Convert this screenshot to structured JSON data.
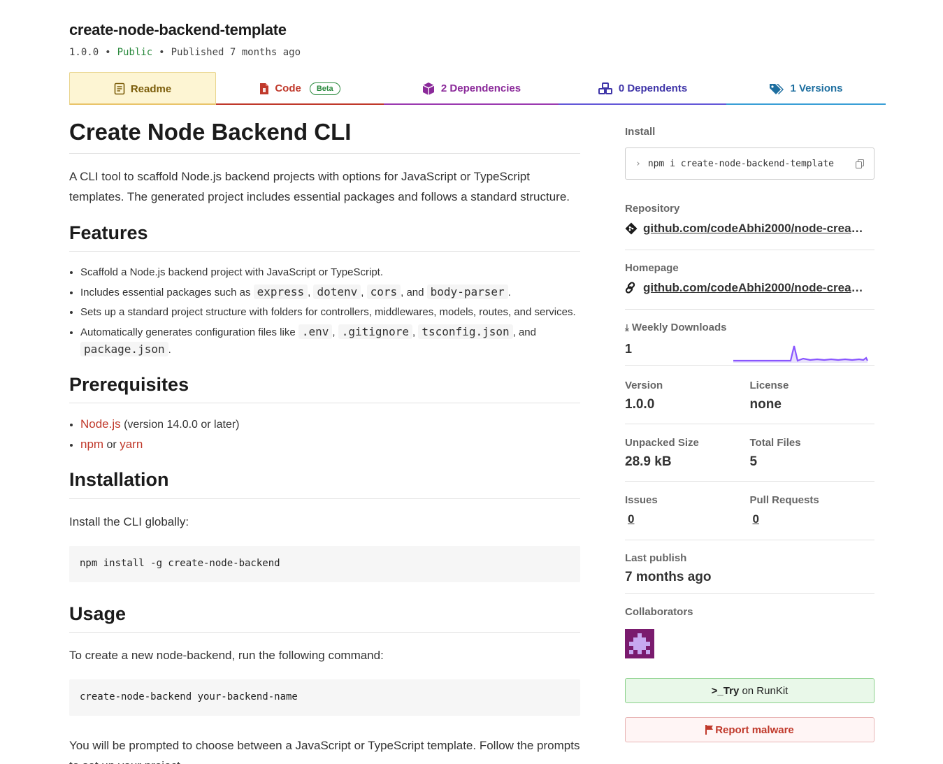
{
  "package": {
    "name": "create-node-backend-template",
    "version": "1.0.0",
    "visibility": "Public",
    "published": "Published 7 months ago"
  },
  "tabs": [
    {
      "label": "Readme",
      "icon": "readme-icon"
    },
    {
      "label": "Code",
      "badge": "Beta",
      "icon": "code-file-icon"
    },
    {
      "label": "2 Dependencies",
      "icon": "box-icon"
    },
    {
      "label": "0 Dependents",
      "icon": "boxes-icon"
    },
    {
      "label": "1 Versions",
      "icon": "tags-icon"
    }
  ],
  "readme": {
    "title": "Create Node Backend CLI",
    "intro": "A CLI tool to scaffold Node.js backend projects with options for JavaScript or TypeScript templates. The generated project includes essential packages and follows a standard structure.",
    "features_heading": "Features",
    "features": {
      "f1": "Scaffold a Node.js backend project with JavaScript or TypeScript.",
      "f2_pre": "Includes essential packages such as",
      "f2_c1": "express",
      "f2_c2": "dotenv",
      "f2_c3": "cors",
      "f2_and": ", and",
      "f2_c4": "body-parser",
      "f3": "Sets up a standard project structure with folders for controllers, middlewares, models, routes, and services.",
      "f4_pre": "Automatically generates configuration files like",
      "f4_c1": ".env",
      "f4_c2": ".gitignore",
      "f4_c3": "tsconfig.json",
      "f4_and": ", and",
      "f4_c4": "package.json"
    },
    "prereq_heading": "Prerequisites",
    "prereq": {
      "node_link": "Node.js",
      "node_note": "(version 14.0.0 or later)",
      "npm_link": "npm",
      "or": "or",
      "yarn_link": "yarn"
    },
    "install_heading": "Installation",
    "install_text": "Install the CLI globally:",
    "install_code": "npm install -g create-node-backend",
    "usage_heading": "Usage",
    "usage_text": "To create a new node-backend, run the following command:",
    "usage_code": "create-node-backend your-backend-name",
    "usage_after": "You will be prompted to choose between a JavaScript or TypeScript template. Follow the prompts to set up your project."
  },
  "sidebar": {
    "install_label": "Install",
    "install_cmd": "npm i create-node-backend-template",
    "repository_label": "Repository",
    "repository_link": "github.com/codeAbhi2000/node-create…",
    "homepage_label": "Homepage",
    "homepage_link": "github.com/codeAbhi2000/node-creat…",
    "weekly_label": "Weekly Downloads",
    "weekly_value": "1",
    "version_label": "Version",
    "version_value": "1.0.0",
    "license_label": "License",
    "license_value": "none",
    "unpacked_label": "Unpacked Size",
    "unpacked_value": "28.9 kB",
    "files_label": "Total Files",
    "files_value": "5",
    "issues_label": "Issues",
    "issues_value": "0",
    "pr_label": "Pull Requests",
    "pr_value": "0",
    "lastpub_label": "Last publish",
    "lastpub_value": "7 months ago",
    "collab_label": "Collaborators",
    "runkit_prefix": ">_",
    "runkit_try": "Try",
    "runkit_rest": "on RunKit",
    "malware_label": "Report malware"
  },
  "colors": {
    "accent_red": "#c0392b",
    "public_green": "#2b8a3e",
    "sparkline": "#8956ff"
  }
}
